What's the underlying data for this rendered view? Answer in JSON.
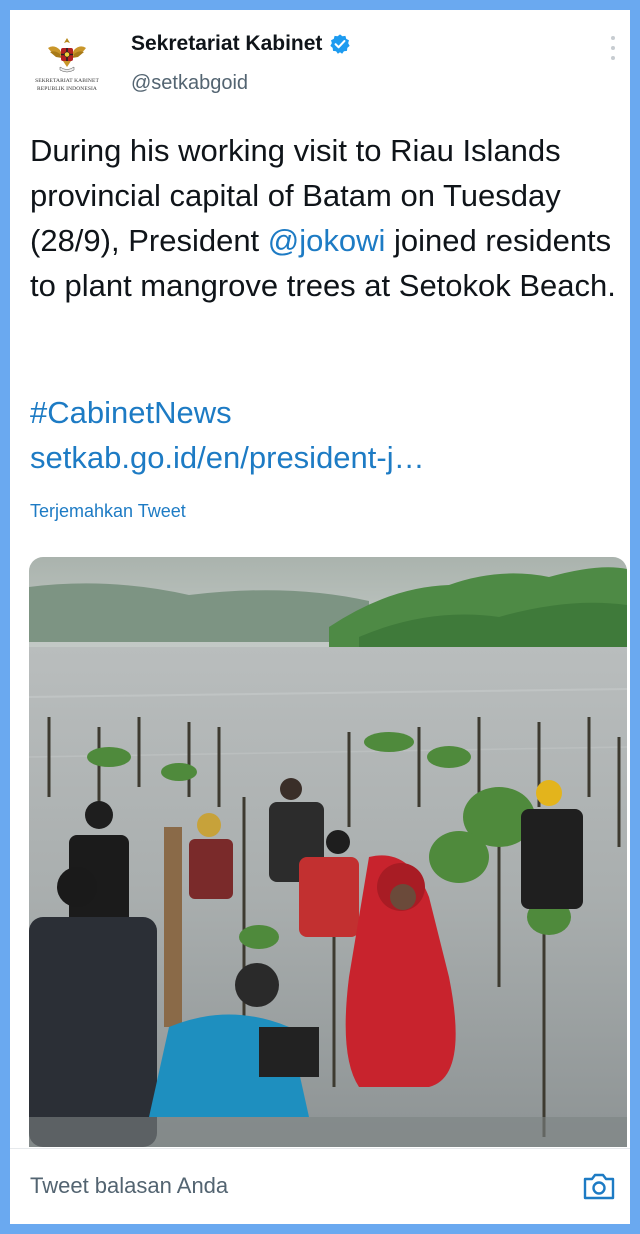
{
  "account": {
    "display_name": "Sekretariat Kabinet",
    "handle": "@setkabgoid",
    "verified": true,
    "avatar_text_line1": "SEKRETARIAT KABINET",
    "avatar_text_line2": "REPUBLIK INDONESIA"
  },
  "tweet": {
    "text_part1": "During his working visit to Riau Islands provincial capital of Batam on Tuesday (28/9), President ",
    "mention": "@jokowi",
    "text_part2": " joined residents to plant mangrove trees at Setokok Beach.",
    "hashtag": "#CabinetNews",
    "link": "setkab.go.id/en/president-j…",
    "translate_label": "Terjemahkan Tweet",
    "image_icon": "photo-mangrove-planting"
  },
  "reply": {
    "placeholder": "Tweet balasan Anda",
    "camera_icon": "camera-icon"
  },
  "colors": {
    "frame": "#6aa9f0",
    "link": "#1d7bc4",
    "verified": "#1d9bf0",
    "text": "#0f1419",
    "muted": "#536471"
  }
}
